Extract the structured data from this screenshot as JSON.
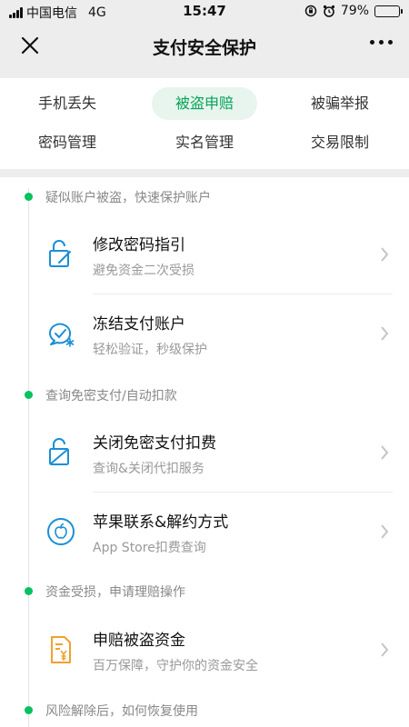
{
  "status_bar": {
    "carrier": "中国电信",
    "network": "4G",
    "time": "15:47",
    "battery": "79%",
    "battery_level": 0.79
  },
  "nav": {
    "title": "支付安全保护"
  },
  "tabs": [
    {
      "label": "手机丢失"
    },
    {
      "label": "被盗申赔",
      "active": true
    },
    {
      "label": "被骗举报"
    },
    {
      "label": "密码管理"
    },
    {
      "label": "实名管理"
    },
    {
      "label": "交易限制"
    }
  ],
  "sections": [
    {
      "title": "疑似账户被盗，快速保护账户",
      "items": [
        {
          "title": "修改密码指引",
          "subtitle": "避免资金二次受损",
          "icon": "lock-edit-icon"
        },
        {
          "title": "冻结支付账户",
          "subtitle": "轻松验证，秒级保护",
          "icon": "freeze-icon"
        }
      ]
    },
    {
      "title": "查询免密支付/自动扣款",
      "items": [
        {
          "title": "关闭免密支付扣费",
          "subtitle": "查询&关闭代扣服务",
          "icon": "no-password-icon"
        },
        {
          "title": "苹果联系&解约方式",
          "subtitle": "App Store扣费查询",
          "icon": "apple-icon"
        }
      ]
    },
    {
      "title": "资金受损，申请理赔操作",
      "items": [
        {
          "title": "申赔被盗资金",
          "subtitle": "百万保障，守护你的资金安全",
          "icon": "claim-document-icon"
        }
      ]
    },
    {
      "title": "风险解除后，如何恢复使用",
      "items": []
    }
  ],
  "colors": {
    "accent": "#07c160",
    "active_tab_bg": "#e8f5ee",
    "active_tab_text": "#07a35a",
    "icon_blue": "#1a8fd6",
    "icon_orange": "#f0a030"
  }
}
